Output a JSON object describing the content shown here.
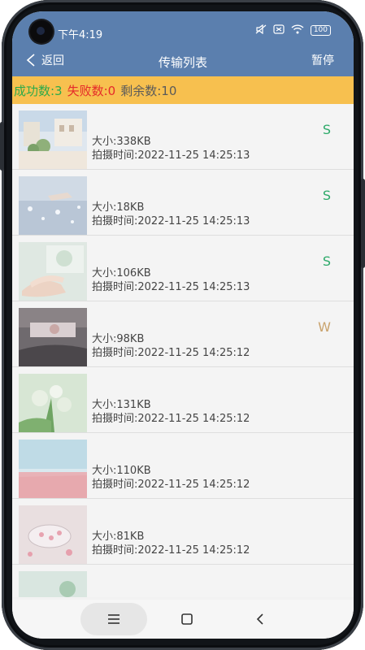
{
  "status_bar": {
    "time": "下午4:19",
    "battery": "100",
    "icons": [
      "camera-icon",
      "mute-icon",
      "signal-off-icon",
      "wifi-icon",
      "battery-icon"
    ]
  },
  "nav": {
    "back_label": "返回",
    "title": "传输列表",
    "pause_label": "暂停"
  },
  "summary": {
    "success": "成功数:3",
    "failed": "失败数:0",
    "remaining": "剩余数:10"
  },
  "items": [
    {
      "size": "大小:338KB",
      "time": "拍摄时间:2022-11-25 14:25:13",
      "status": "S"
    },
    {
      "size": "大小:18KB",
      "time": "拍摄时间:2022-11-25 14:25:13",
      "status": "S"
    },
    {
      "size": "大小:106KB",
      "time": "拍摄时间:2022-11-25 14:25:13",
      "status": "S"
    },
    {
      "size": "大小:98KB",
      "time": "拍摄时间:2022-11-25 14:25:12",
      "status": "W"
    },
    {
      "size": "大小:131KB",
      "time": "拍摄时间:2022-11-25 14:25:12",
      "status": ""
    },
    {
      "size": "大小:110KB",
      "time": "拍摄时间:2022-11-25 14:25:12",
      "status": ""
    },
    {
      "size": "大小:81KB",
      "time": "拍摄时间:2022-11-25 14:25:12",
      "status": ""
    }
  ],
  "colors": {
    "header": "#5b7fae",
    "summary_bar": "#f7c04f",
    "success": "#2eaa4a",
    "failed": "#e52a2a",
    "status_s": "#2eaa6a",
    "status_w": "#c9a36d"
  }
}
